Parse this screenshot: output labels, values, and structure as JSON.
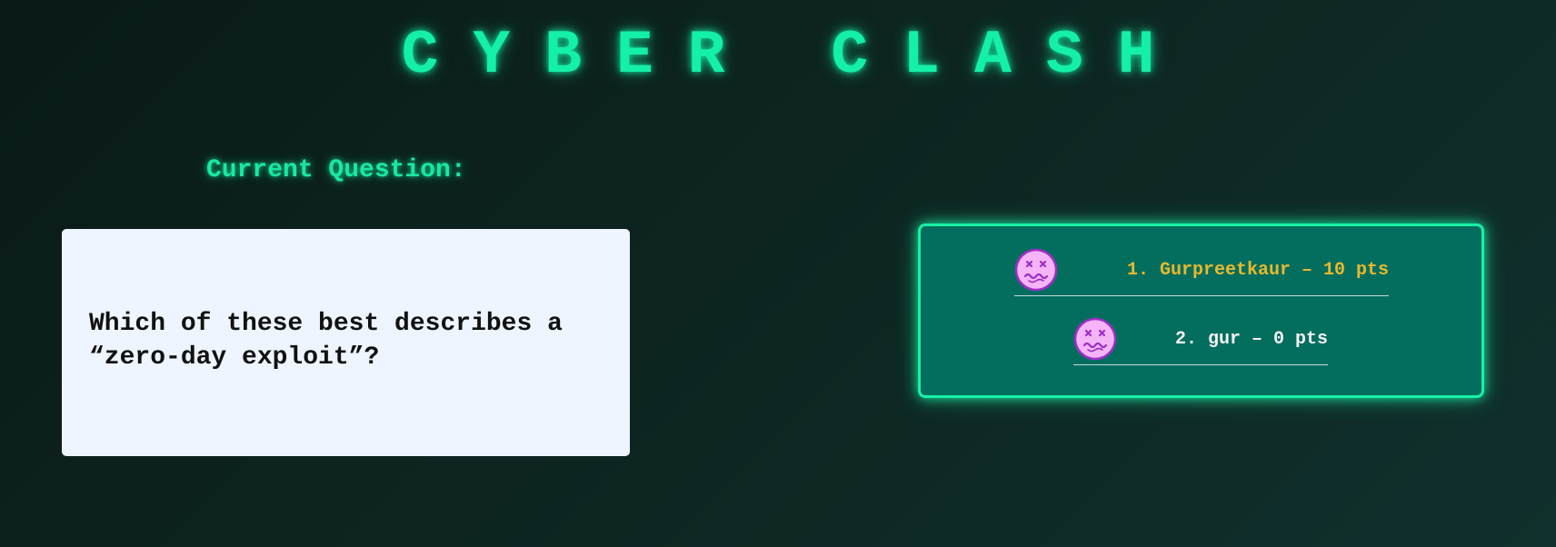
{
  "header": {
    "title": "CYBER CLASH"
  },
  "question": {
    "label": "Current Question:",
    "text": "Which of these best describes a “zero-day exploit”?"
  },
  "leaderboard": {
    "entries": [
      {
        "text": "1. Gurpreetkaur – 10 pts",
        "avatar_icon": "dizzy-face-icon",
        "color": "#e8b82c"
      },
      {
        "text": "2. gur – 0 pts",
        "avatar_icon": "dizzy-face-icon",
        "color": "#f2f2f2"
      }
    ]
  },
  "colors": {
    "accent": "#14f0a8",
    "panel": "#046e5e",
    "avatar": "#f4b4f7"
  }
}
